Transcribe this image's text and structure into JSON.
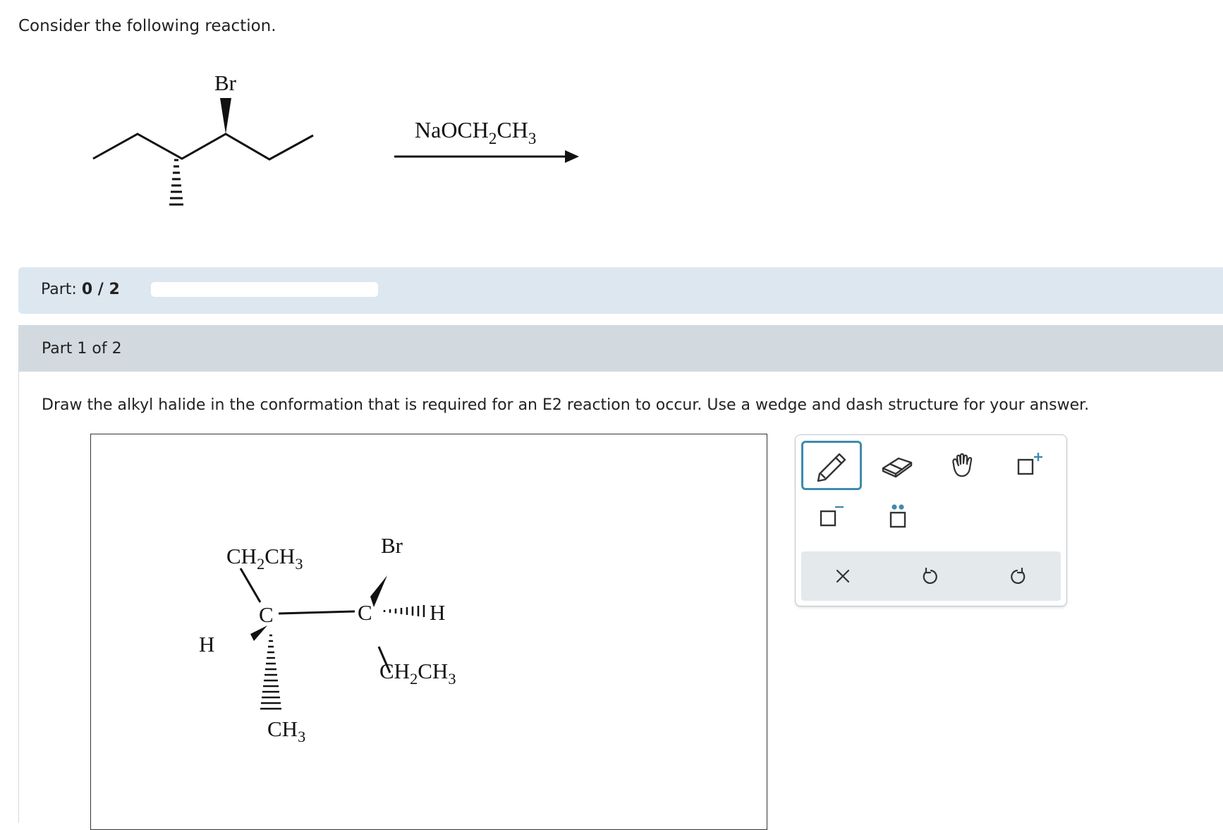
{
  "question": {
    "intro": "Consider the following reaction.",
    "reactant_label_br": "Br",
    "reagent": {
      "prefix": "NaOCH",
      "sub1": "2",
      "mid": "CH",
      "sub2": "3"
    }
  },
  "part_bar": {
    "label": "Part:",
    "score": "0 / 2",
    "progress": 0
  },
  "part_header": {
    "label": "Part 1 of 2"
  },
  "prompt": "Draw the alkyl halide in the conformation that is required for an E2 reaction to occur. Use a wedge and dash structure for your answer.",
  "drawing": {
    "ethyl_left": {
      "a": "CH",
      "s1": "2",
      "b": "CH",
      "s2": "3"
    },
    "ethyl_right": {
      "a": "CH",
      "s1": "2",
      "b": "CH",
      "s2": "3"
    },
    "methyl": {
      "a": "CH",
      "s": "3"
    },
    "c_left": "C",
    "c_right": "C",
    "h_left": "H",
    "h_right": "H",
    "br": "Br"
  },
  "toolbox": {
    "accent": "#3f8bad",
    "tools": [
      "pencil-icon",
      "eraser-icon",
      "hand-icon",
      "charge-plus-icon",
      "charge-minus-icon",
      "lone-pair-icon"
    ],
    "actions": [
      "clear-icon",
      "undo-icon",
      "redo-icon"
    ]
  }
}
